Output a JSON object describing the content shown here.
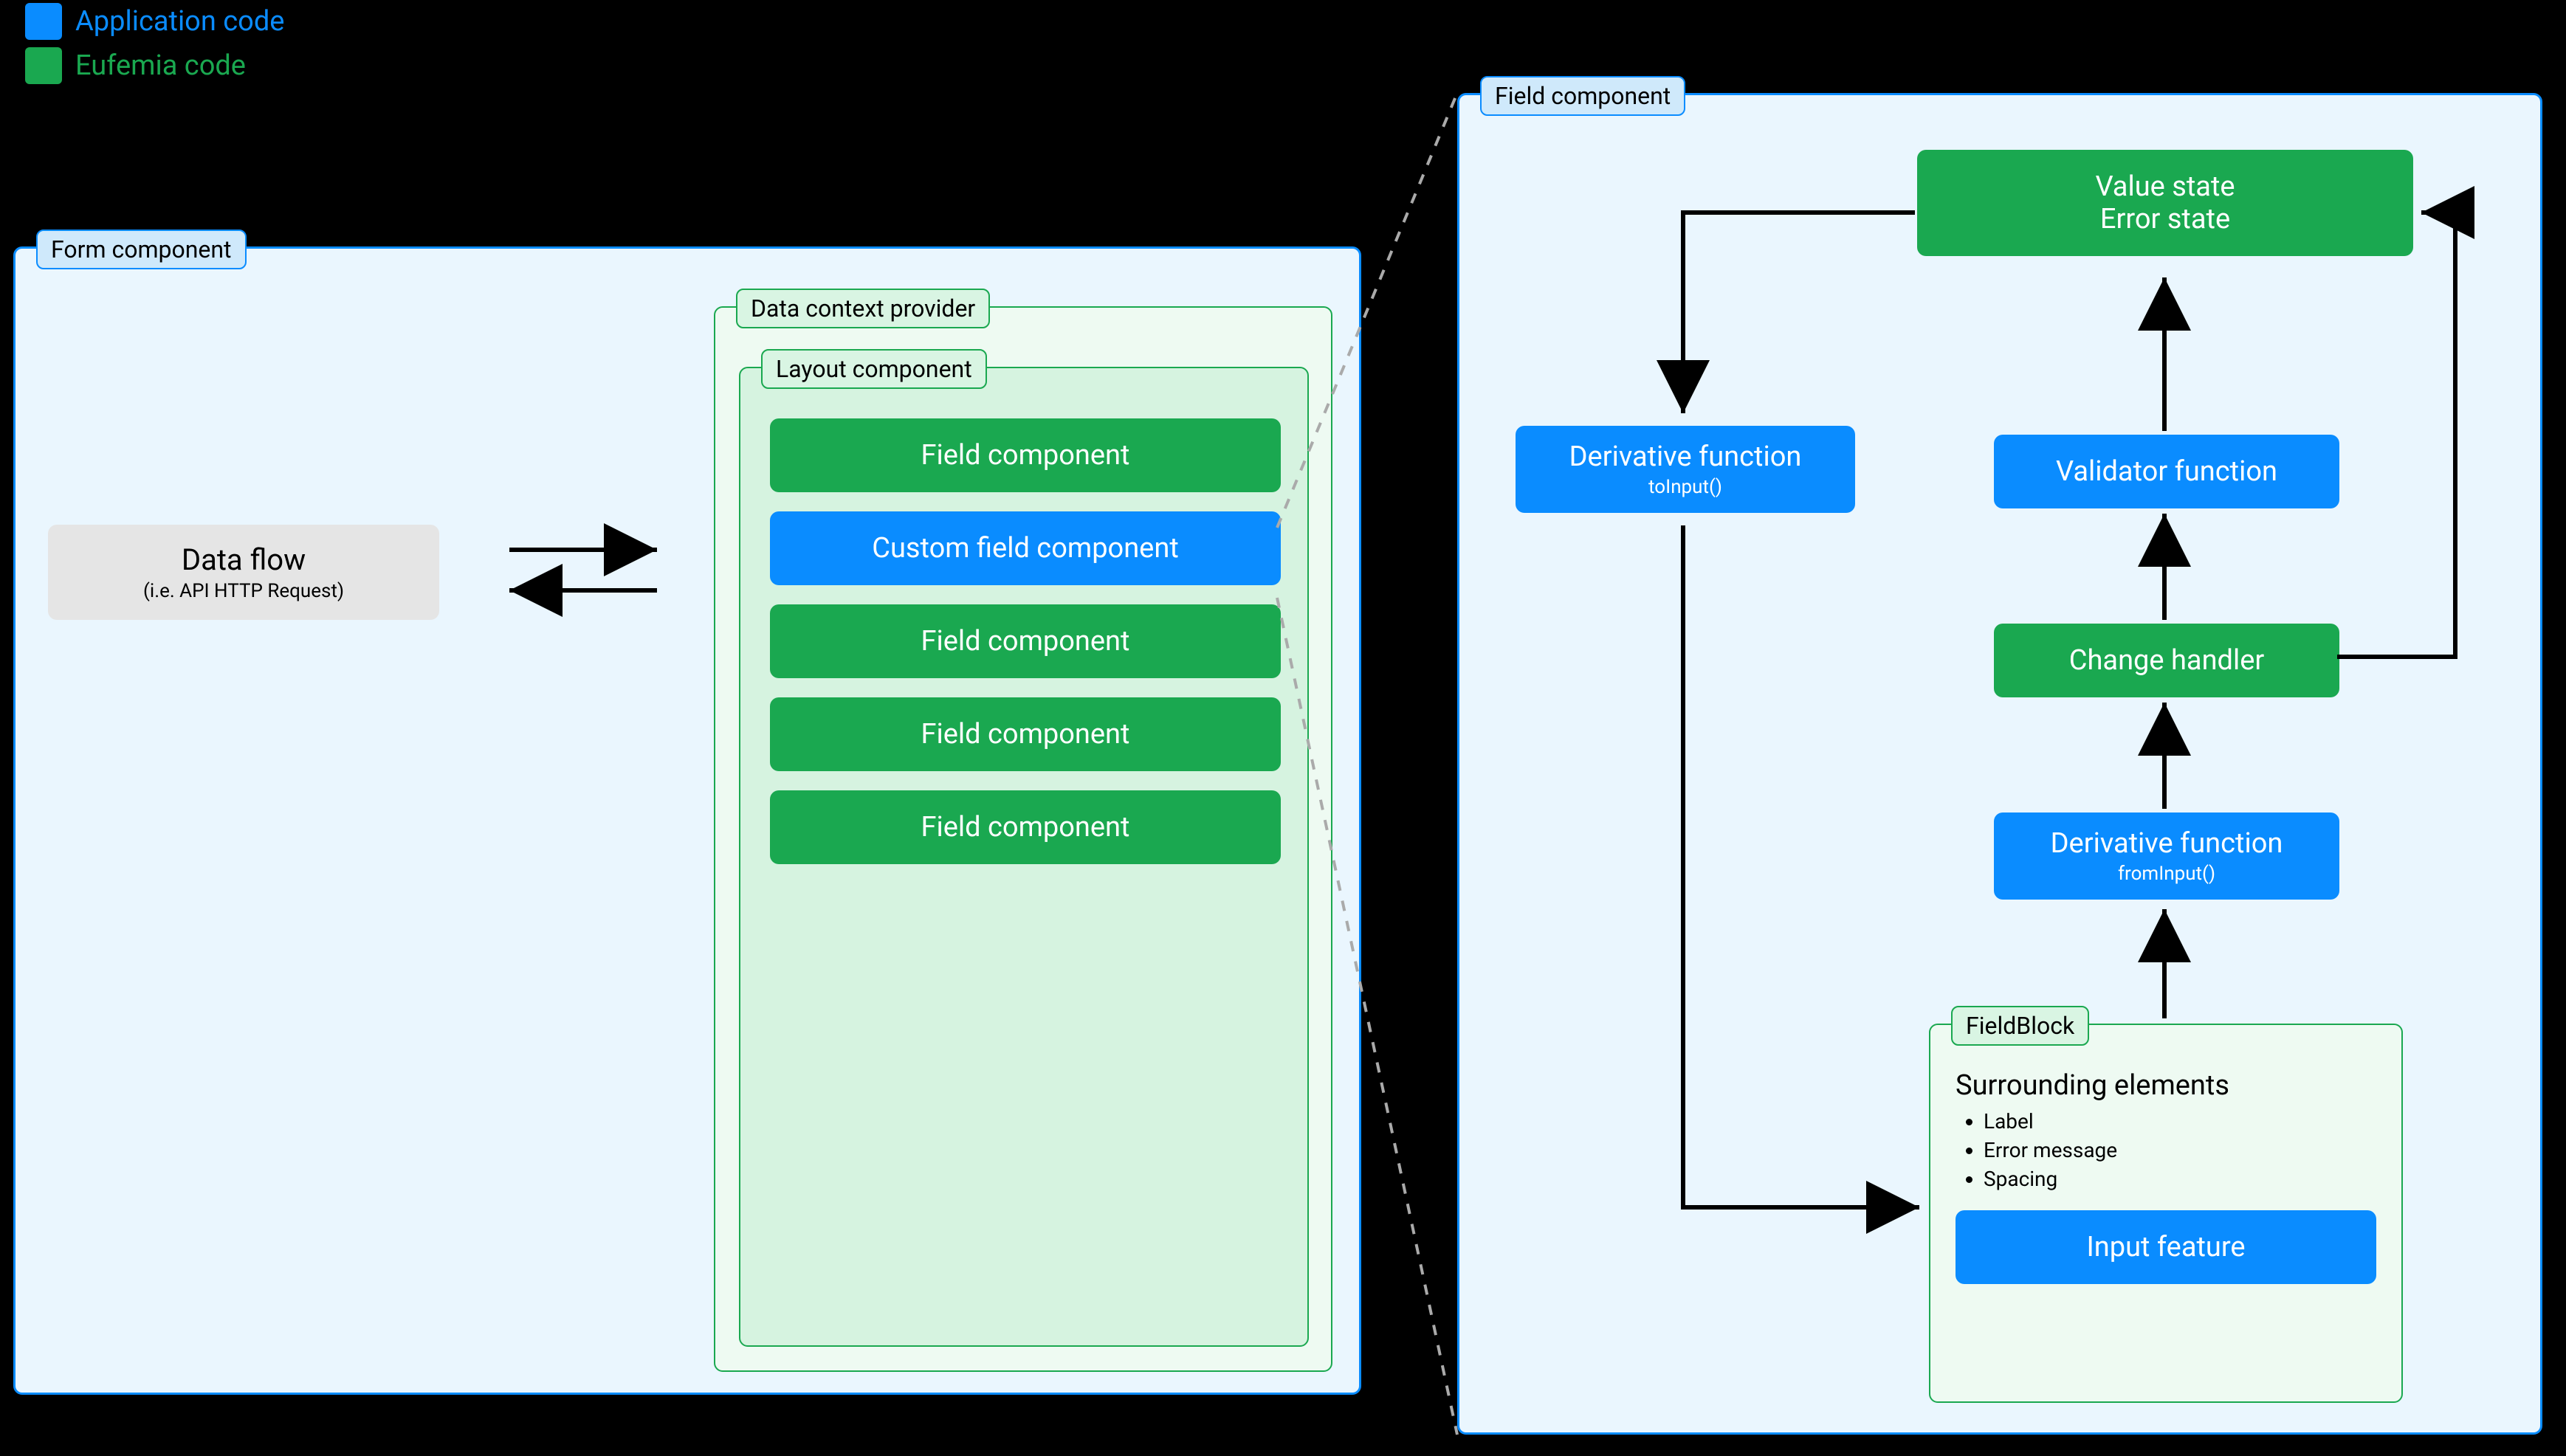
{
  "legend": {
    "app_label": "Application code",
    "eufemia_label": "Eufemia code"
  },
  "form_panel": {
    "badge": "Form component",
    "data_flow_title": "Data flow",
    "data_flow_sub": "(i.e. API HTTP Request)",
    "data_context_badge": "Data context provider",
    "layout_badge": "Layout component",
    "items": [
      {
        "label": "Field component",
        "kind": "green"
      },
      {
        "label": "Custom field component",
        "kind": "blue"
      },
      {
        "label": "Field component",
        "kind": "green"
      },
      {
        "label": "Field component",
        "kind": "green"
      },
      {
        "label": "Field component",
        "kind": "green"
      }
    ]
  },
  "field_panel": {
    "badge": "Field component",
    "value_state_line1": "Value state",
    "value_state_line2": "Error state",
    "derivative_toinput_title": "Derivative function",
    "derivative_toinput_sub": "toInput()",
    "validator_label": "Validator function",
    "change_handler_label": "Change handler",
    "derivative_frominput_title": "Derivative function",
    "derivative_frominput_sub": "fromInput()",
    "fieldblock_badge": "FieldBlock",
    "fieldblock_title": "Surrounding elements",
    "fieldblock_items": [
      "Label",
      "Error message",
      "Spacing"
    ],
    "input_feature_label": "Input feature"
  }
}
